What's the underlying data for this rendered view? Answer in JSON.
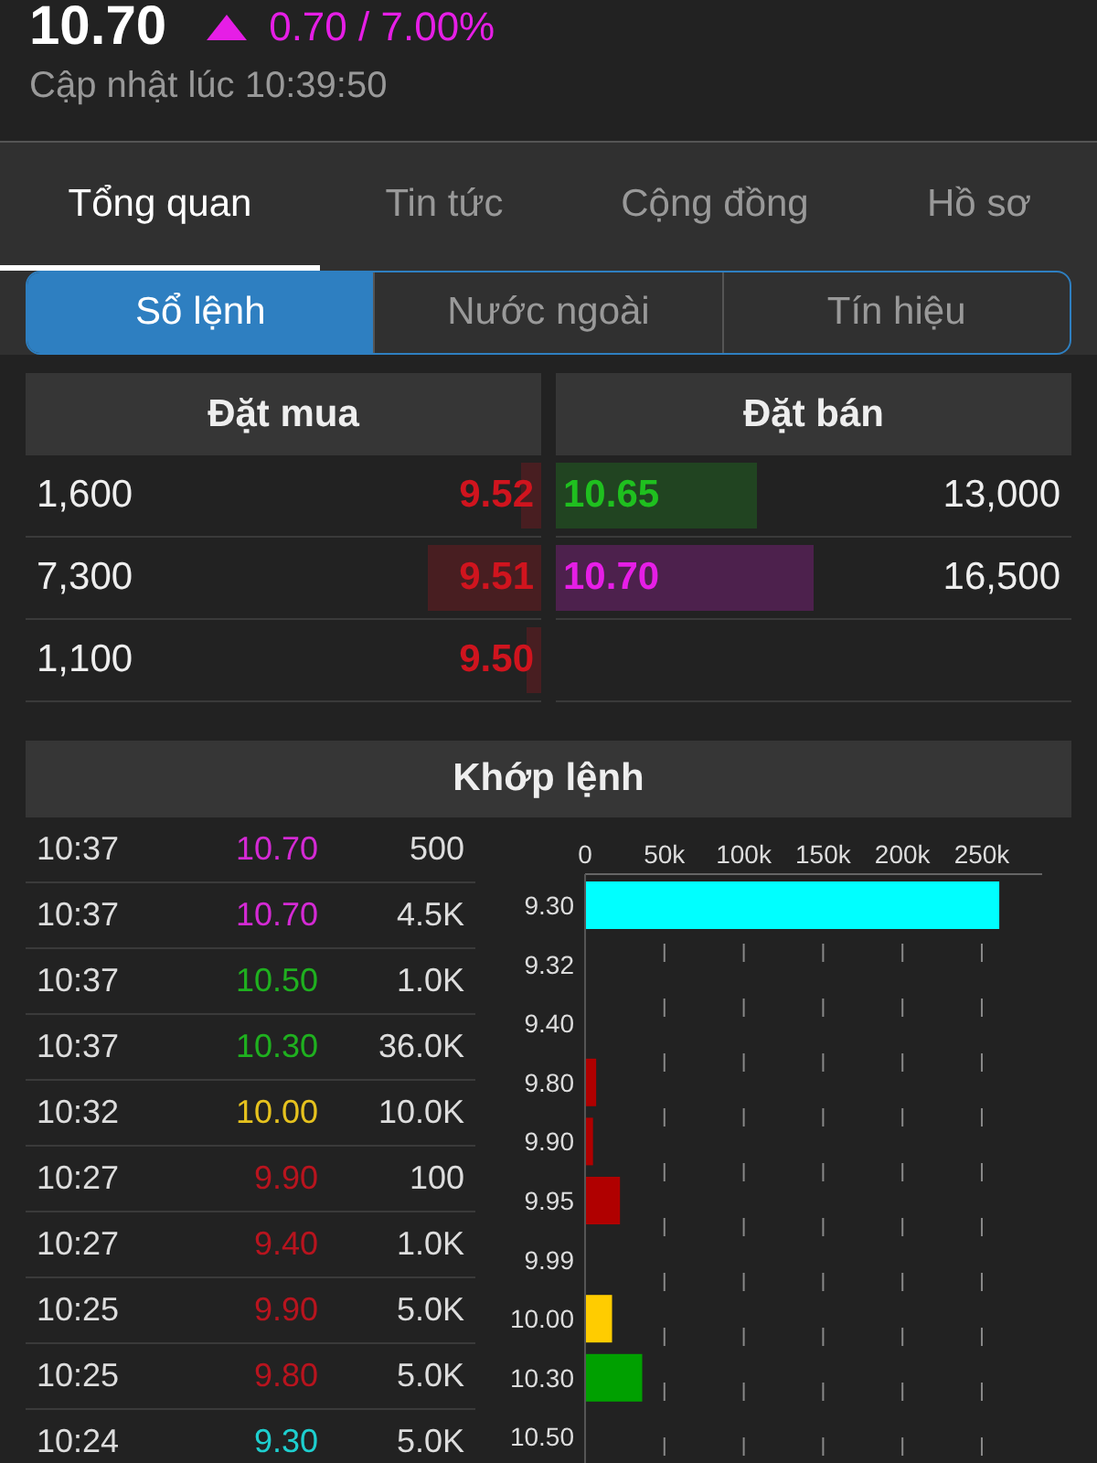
{
  "quote": {
    "price": "10.70",
    "change": "0.70 / 7.00%",
    "updated": "Cập nhật lúc 10:39:50"
  },
  "tabs": [
    {
      "label": "Tổng quan",
      "selected": true
    },
    {
      "label": "Tin tức",
      "selected": false
    },
    {
      "label": "Cộng đồng",
      "selected": false
    },
    {
      "label": "Hồ sơ",
      "selected": false
    }
  ],
  "segments": [
    {
      "label": "Sổ lệnh",
      "selected": true
    },
    {
      "label": "Nước ngoài",
      "selected": false
    },
    {
      "label": "Tín hiệu",
      "selected": false
    }
  ],
  "order_book": {
    "buy_title": "Đặt mua",
    "sell_title": "Đặt bán",
    "bids": [
      {
        "volume": "1,600",
        "price": "9.52",
        "color": "#d0141e",
        "level": 0.04
      },
      {
        "volume": "7,300",
        "price": "9.51",
        "color": "#d0141e",
        "level": 0.22
      },
      {
        "volume": "1,100",
        "price": "9.50",
        "color": "#d0141e",
        "level": 0.03
      }
    ],
    "asks": [
      {
        "price": "10.65",
        "volume": "13,000",
        "color": "#1fc01f",
        "level": 0.39
      },
      {
        "price": "10.70",
        "volume": "16,500",
        "color": "#e61ee6",
        "level": 0.5
      }
    ]
  },
  "matched": {
    "title": "Khớp lệnh",
    "trades": [
      {
        "time": "10:37",
        "price": "10.70",
        "volume": "500",
        "color": "#d42ad4"
      },
      {
        "time": "10:37",
        "price": "10.70",
        "volume": "4.5K",
        "color": "#d42ad4"
      },
      {
        "time": "10:37",
        "price": "10.50",
        "volume": "1.0K",
        "color": "#1fb01f"
      },
      {
        "time": "10:37",
        "price": "10.30",
        "volume": "36.0K",
        "color": "#1fb01f"
      },
      {
        "time": "10:32",
        "price": "10.00",
        "volume": "10.0K",
        "color": "#e6c21e"
      },
      {
        "time": "10:27",
        "price": "9.90",
        "volume": "100",
        "color": "#b8141e"
      },
      {
        "time": "10:27",
        "price": "9.40",
        "volume": "1.0K",
        "color": "#b8141e"
      },
      {
        "time": "10:25",
        "price": "9.90",
        "volume": "5.0K",
        "color": "#b8141e"
      },
      {
        "time": "10:25",
        "price": "9.80",
        "volume": "5.0K",
        "color": "#b8141e"
      },
      {
        "time": "10:24",
        "price": "9.30",
        "volume": "5.0K",
        "color": "#1ecfcf"
      }
    ],
    "chart_data": {
      "type": "bar",
      "orientation": "horizontal",
      "stacked": true,
      "grid": true,
      "xlim": [
        0,
        288000
      ],
      "categories": [
        "9.30",
        "9.32",
        "9.40",
        "9.80",
        "9.90",
        "9.95",
        "9.99",
        "10.00",
        "10.30",
        "10.50"
      ],
      "xticks": [
        {
          "value": 0,
          "label": "0"
        },
        {
          "value": 50000,
          "label": "50k"
        },
        {
          "value": 100000,
          "label": "100k"
        },
        {
          "value": 150000,
          "label": "150k"
        },
        {
          "value": 200000,
          "label": "200k"
        },
        {
          "value": 250000,
          "label": "250k"
        }
      ],
      "series": [
        {
          "color": "#00ffff",
          "values": [
            261000,
            null,
            null,
            null,
            null,
            null,
            null,
            null,
            null,
            null
          ]
        },
        {
          "color": "#b00000",
          "values": [
            null,
            0,
            null,
            7000,
            5000,
            22000,
            0,
            null,
            null,
            null
          ]
        },
        {
          "color": "#ffcc00",
          "values": [
            null,
            null,
            null,
            null,
            null,
            null,
            null,
            17000,
            null,
            null
          ]
        },
        {
          "color": "#00a000",
          "values": [
            null,
            null,
            null,
            null,
            null,
            null,
            null,
            null,
            36000,
            null
          ]
        }
      ]
    }
  }
}
